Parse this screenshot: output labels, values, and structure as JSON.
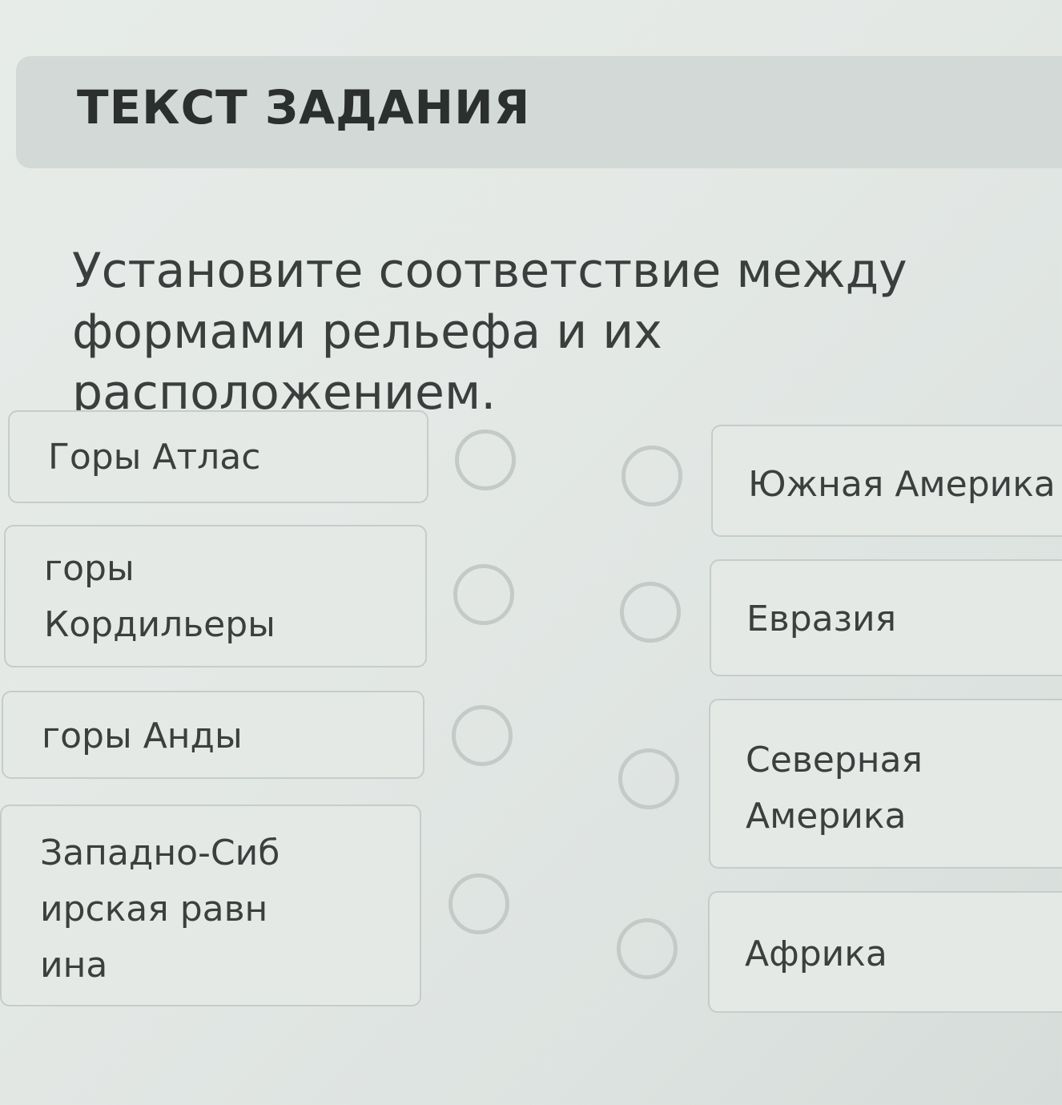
{
  "header": {
    "title": "ТЕКСТ ЗАДАНИЯ"
  },
  "question": {
    "text": "Установите соответствие между формами рельефа и их расположением."
  },
  "left_items": [
    {
      "label": "Горы Атлас"
    },
    {
      "label": "горы Кордильеры"
    },
    {
      "label": "горы Анды"
    },
    {
      "label": "Западно-Сибирская равнина"
    }
  ],
  "right_items": [
    {
      "label": "Южная Америка"
    },
    {
      "label": "Евразия"
    },
    {
      "label": "Северная Америка"
    },
    {
      "label": "Африка"
    }
  ]
}
